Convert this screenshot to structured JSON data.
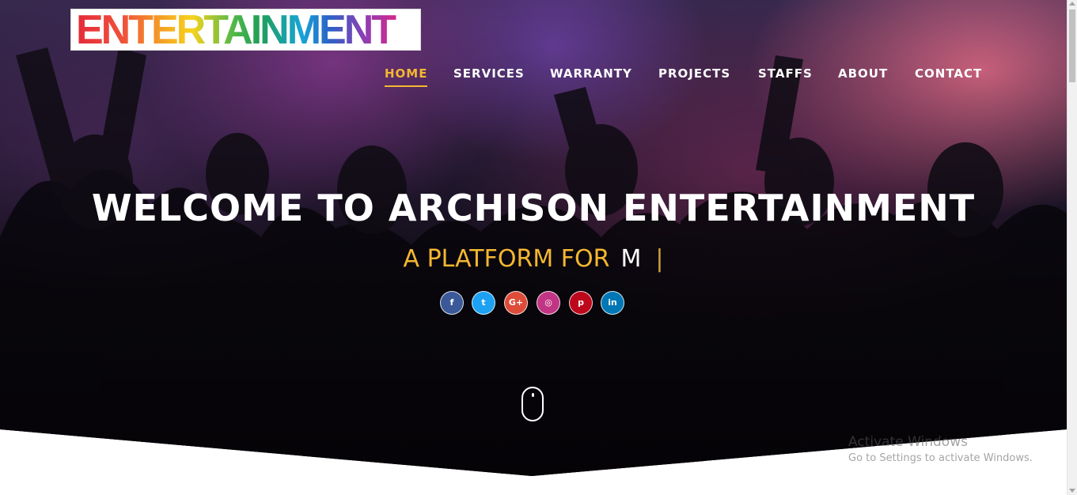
{
  "logo": {
    "text": "ENTERTAINMENT"
  },
  "nav": {
    "items": [
      {
        "label": "HOME",
        "active": true
      },
      {
        "label": "SERVICES",
        "active": false
      },
      {
        "label": "WARRANTY",
        "active": false
      },
      {
        "label": "PROJECTS",
        "active": false
      },
      {
        "label": "STAFFS",
        "active": false
      },
      {
        "label": "ABOUT",
        "active": false
      },
      {
        "label": "CONTACT",
        "active": false
      }
    ]
  },
  "hero": {
    "headline": "WELCOME TO ARCHISON ENTERTAINMENT",
    "tagline_lead": "A PLATFORM FOR",
    "tagline_typed": "M",
    "tagline_cursor": "|"
  },
  "socials": [
    {
      "icon": "facebook-icon",
      "glyph": "f",
      "color": "#3b5998"
    },
    {
      "icon": "twitter-icon",
      "glyph": "t",
      "color": "#1da1f2"
    },
    {
      "icon": "google-plus-icon",
      "glyph": "G+",
      "color": "#dd4b39"
    },
    {
      "icon": "instagram-icon",
      "glyph": "◎",
      "color": "#c13584"
    },
    {
      "icon": "pinterest-icon",
      "glyph": "p",
      "color": "#bd081c"
    },
    {
      "icon": "linkedin-icon",
      "glyph": "in",
      "color": "#0077b5"
    }
  ],
  "colors": {
    "accent": "#f5b731",
    "white": "#ffffff"
  },
  "watermark": {
    "title": "Activate Windows",
    "subtitle": "Go to Settings to activate Windows."
  }
}
